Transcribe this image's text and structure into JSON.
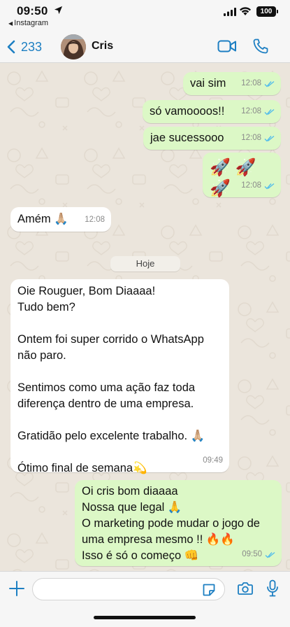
{
  "status_bar": {
    "time": "09:50",
    "back_app": "Instagram",
    "battery": "100"
  },
  "header": {
    "back_count": "233",
    "contact_name": "Cris"
  },
  "day_separator": "Hoje",
  "messages": [
    {
      "text": "vai sim",
      "time": "12:08",
      "direction": "outgoing",
      "read": true
    },
    {
      "text": "só vamoooos!!",
      "time": "12:08",
      "direction": "outgoing",
      "read": true
    },
    {
      "text": "jae sucessooo",
      "time": "12:08",
      "direction": "outgoing",
      "read": true
    },
    {
      "text": "🚀 🚀 🚀",
      "time": "12:08",
      "direction": "outgoing",
      "read": true
    },
    {
      "text": "Amém 🙏🏼",
      "time": "12:08",
      "direction": "incoming"
    },
    {
      "text": "Oie Rouguer, Bom Diaaaa!\nTudo bem?\n\nOntem foi super corrido o WhatsApp\nnão paro.\n\nSentimos como uma ação faz toda\ndiferença dentro de uma empresa.\n\nGratidão pelo excelente trabalho. 🙏🏼\n\nÓtimo final de semana💫",
      "time": "09:49",
      "direction": "incoming"
    },
    {
      "text": "Oi cris bom diaaaa\nNossa que legal 🙏\nO marketing pode mudar o jogo de\numa empresa mesmo !! 🔥🔥\nIsso é só o começo 👊",
      "time": "09:50",
      "direction": "outgoing",
      "read": true
    }
  ],
  "composer": {
    "placeholder": "",
    "value": ""
  },
  "colors": {
    "accent": "#1d7fc2",
    "outgoing_bubble": "#dcf8c6",
    "incoming_bubble": "#ffffff",
    "chat_background": "#ebe5dc",
    "read_ticks": "#53bdeb"
  },
  "icons": {
    "status": [
      "location-arrow-icon",
      "signal-icon",
      "wifi-icon",
      "battery-icon"
    ],
    "header": [
      "chevron-left-icon",
      "video-camera-icon",
      "phone-icon"
    ],
    "composer": [
      "plus-icon",
      "sticker-icon",
      "camera-icon",
      "microphone-icon"
    ]
  }
}
